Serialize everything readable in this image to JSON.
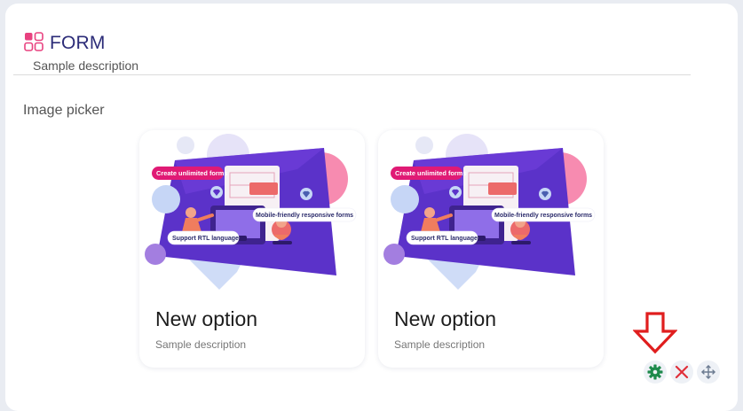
{
  "form": {
    "title": "FORM",
    "description": "Sample description"
  },
  "question": {
    "label": "Image picker"
  },
  "options": [
    {
      "title": "New option",
      "description": "Sample description",
      "image": {
        "badge_top": "Create unlimited forms",
        "badge_right": "Mobile-friendly responsive forms",
        "badge_bottom": "Support RTL language"
      }
    },
    {
      "title": "New option",
      "description": "Sample description",
      "image": {
        "badge_top": "Create unlimited forms",
        "badge_right": "Mobile-friendly responsive forms",
        "badge_bottom": "Support RTL language"
      }
    }
  ],
  "toolbar": {
    "icons": [
      "gear-icon",
      "close-icon",
      "move-icon"
    ],
    "colors": {
      "gear": "#1e8a4c",
      "close": "#e0303a",
      "move": "#6b7a90"
    }
  },
  "annotation": {
    "arrow_color": "#e01e1e"
  },
  "theme": {
    "title_color": "#2c2c78",
    "accent_pink": "#e8417f",
    "accent_purple": "#5b32c9"
  }
}
